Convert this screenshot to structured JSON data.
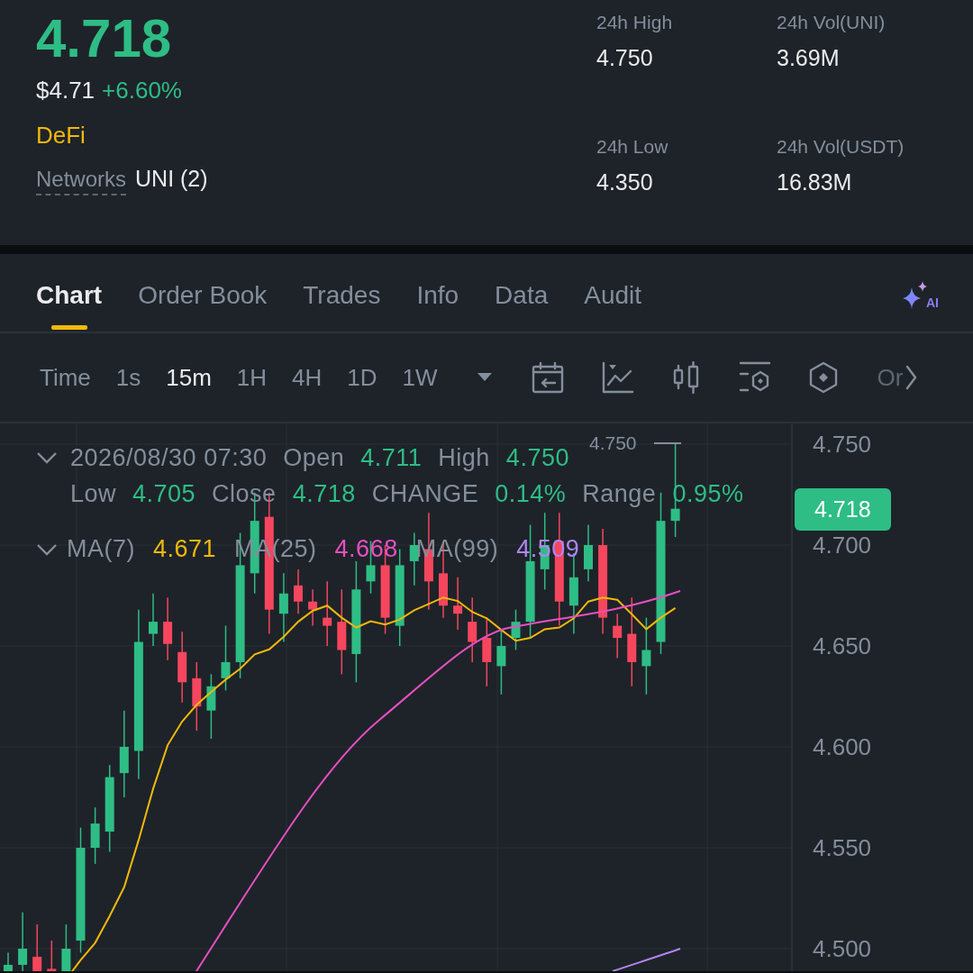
{
  "ticker": {
    "price": "4.718",
    "fiat_price": "$4.71",
    "change": "+6.60%",
    "category": "DeFi",
    "networks_label": "Networks",
    "networks_value": "UNI (2)"
  },
  "stats": [
    {
      "label": "24h High",
      "value": "4.750"
    },
    {
      "label": "24h Vol(UNI)",
      "value": "3.69M"
    },
    {
      "label": "24h Low",
      "value": "4.350"
    },
    {
      "label": "24h Vol(USDT)",
      "value": "16.83M"
    }
  ],
  "tabs": [
    {
      "label": "Chart",
      "selected": true
    },
    {
      "label": "Order Book",
      "selected": false
    },
    {
      "label": "Trades",
      "selected": false
    },
    {
      "label": "Info",
      "selected": false
    },
    {
      "label": "Data",
      "selected": false
    },
    {
      "label": "Audit",
      "selected": false
    }
  ],
  "ai_label": "AI",
  "intervals": [
    {
      "label": "Time",
      "selected": false
    },
    {
      "label": "1s",
      "selected": false
    },
    {
      "label": "15m",
      "selected": true
    },
    {
      "label": "1H",
      "selected": false
    },
    {
      "label": "4H",
      "selected": false
    },
    {
      "label": "1D",
      "selected": false
    },
    {
      "label": "1W",
      "selected": false
    }
  ],
  "toolbar_overflow": "Or",
  "chart": {
    "timestamp": "2026/08/30 07:30",
    "candle_info": [
      {
        "label": "Open",
        "value": "4.711"
      },
      {
        "label": "High",
        "value": "4.750"
      },
      {
        "label": "Low",
        "value": "4.705"
      },
      {
        "label": "Close",
        "value": "4.718"
      },
      {
        "label": "CHANGE",
        "value": "0.14%"
      },
      {
        "label": "Range",
        "value": "0.95%"
      }
    ],
    "moving_averages": [
      {
        "label": "MA(7)",
        "value": "4.671",
        "color": "#f0b90b"
      },
      {
        "label": "MA(25)",
        "value": "4.668",
        "color": "#e84fc2"
      },
      {
        "label": "MA(99)",
        "value": "4.509",
        "color": "#b185f4"
      }
    ],
    "high_marker": "4.750",
    "price_axis": [
      "4.750",
      "4.700",
      "4.650",
      "4.600",
      "4.550",
      "4.500"
    ],
    "last_price": "4.718"
  }
}
